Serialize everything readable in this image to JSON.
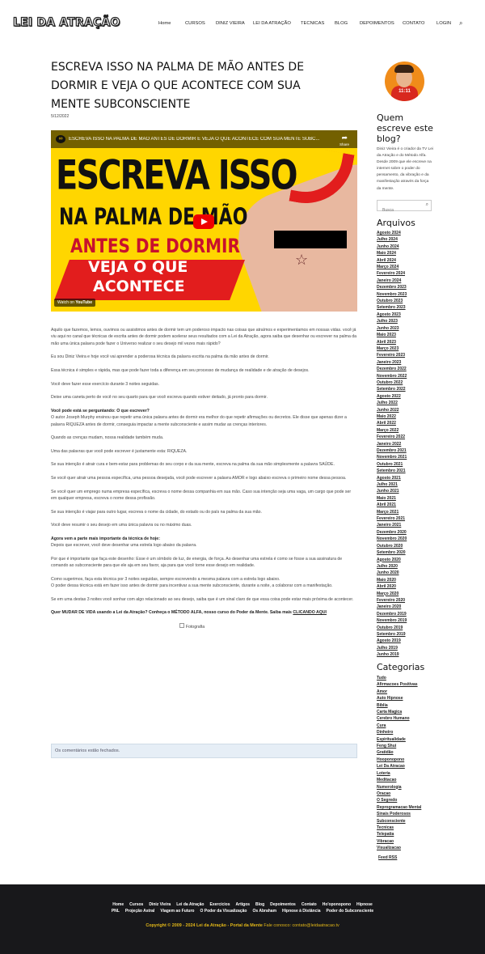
{
  "header": {
    "logo": "LEI DA ATRAÇÃO",
    "nav": [
      "Home",
      "CURSOS",
      "DINIZ VIEIRA",
      "LEI DA ATRAÇÃO",
      "TECNICAS",
      "BLOG",
      "DEPOIMENTOS",
      "CONTATO",
      "LOGIN"
    ],
    "search_icon": "search-icon"
  },
  "post": {
    "title": "ESCREVA ISSO NA PALMA DE MÃO ANTES DE DORMIR E VEJA O QUE ACONTECE COM SUA MENTE SUBCONSCIENTE",
    "date": "5/12/2022",
    "video": {
      "bar_title": "ESCREVA ISSO NA PALMA DE MÃO ANTES DE DORMIR E VEJA O QUE ACONTECE COM SUA MENTE SUBC...",
      "share": "Share",
      "line1": "ESCREVA ISSO",
      "line2": "NA PALMA DE MÃO",
      "line3": "ANTES DE DORMIR",
      "line4": "VEJA O QUE",
      "line5": "ACONTECE",
      "watch_on": "Watch on",
      "youtube": "YouTube"
    },
    "paragraphs": {
      "p1": "Aquilo que fazemos, lemos, ouvimos ou assistimos antes de dormir tem um poderoso impacto nas coisas que atraímos e experimentamos em nossas vidas. você já viu aqui no canal que técnicas de escrita antes de dormir podem acelerar seus resultados com a Lei da Atração, agora saiba que desenhar ou escrever na palma da mão uma única palavra pode fazer o Universo realizar o seu desejo mil vezes mais rápido?",
      "p2": "Eu sou Diniz Vieira e hoje você vai aprender a poderosa técnica da palavra escrita na palma da mão antes de dormir.",
      "p3": "Essa técnica é simples e rápida, mas que pode fazer toda a diferença em seu processo de mudança de realidade e de atração de desejos.",
      "p4": "Você deve fazer esse exercício durante 3 noites seguidas.",
      "p5": "Deixe uma caneta perto de você no seu quarto para que você escreva quando estiver deitado, já pronto para dormir.",
      "p6_bold": "Você pode está se perguntando: O que escrever?",
      "p6": "O autor Joseph Murphy ensinou que repetir uma única palavra antes de dormir era melhor do que repetir afirmações ou decretos. Ele disse que apenas dizer a palavra RIQUEZA antes de dormir, conseguia impactar a mente subconsciente e assim mudar as crenças interiores.",
      "p7": "Quando as crenças mudam, nossa realidade também muda.",
      "p8": "Uma das palavras que você pode escrever é justamente esta: RIQUEZA.",
      "p9": "Se sua intenção é atrair cura e bem-estar para problemas do seu corpo e da sua mente, escreva na palma da sua mão simplesmente a palavra SAÚDE.",
      "p10": "Se você quer atrair uma pessoa específica, uma pessoa desejada, você pode escrever a palavra AMOR e logo abaixo escreva o primeiro nome dessa pessoa.",
      "p11": "Se você quer um emprego numa empresa específica, escreva o nome dessa companhia em sua mão. Caso sua intenção seja uma vaga, um cargo que pode ser em qualquer empresa, escreva o nome dessa profissão.",
      "p12": "Se sua intenção é viajar para outro lugar, escreva o nome da cidade, do estado ou do país na palma da sua mão.",
      "p13": "Você deve resumir o seu desejo em uma única palavra ou no máximo duas.",
      "p14_bold": "Agora vem a parte mais importante da técnica de hoje:",
      "p14": "Depois que escrever, você deve desenhar uma estrela logo abaixo da palavra.",
      "p15": "Por que é importante que faça este desenho: Esse é um símbolo de luz, de energia, de força. Ao desenhar uma estrela é como se fosse a sua assinatura de comando ao subconsciente para que ele aja em seu favor, aja para que você torne esse desejo em realidade.",
      "p16a": "Como sugerimos, faça esta técnica por 3 noites seguidas, sempre escrevendo a mesma palavra com a estrela logo abaixo.",
      "p16b": "O poder dessa técnica está em fazer isso antes de dormir para incentivar a sua mente subconsciente, durante a noite, a colaborar com a manifestação.",
      "p17": "Se em uma destas 3 noites você sonhar com algo relacionado ao seu desejo, saiba que é um sinal claro de que essa coisa pode estar mais próxima de acontecer.",
      "cta": "Quer MUDAR DE VIDA usando a Lei da Atração? Conheça o MÉTODO ALFA, nosso curso do Poder da Mente. Saiba mais",
      "cta_link": "CLICANDO AQUI",
      "figure_alt": "Fotografia"
    },
    "comments_closed": "Os comentários estão fechados."
  },
  "sidebar": {
    "avatar_label": "11:11",
    "about_title": "Quem escreve este blog?",
    "about_text": "Diniz Vieira é o criador da TV Lei da Atração e do Método Alfa. Desde 2009 que ele escreve na internet sobre o poder do pensamento, da vibração e da manifestação através da força da mente.",
    "search_placeholder": "Busca",
    "archives_title": "Arquivos",
    "archives": [
      "Agosto 2024",
      "Julho 2024",
      "Junho 2024",
      "Maio 2024",
      "Abril 2024",
      "Março 2024",
      "Fevereiro 2024",
      "Janeiro 2024",
      "Dezembro 2023",
      "Novembro 2023",
      "Outubro 2023",
      "Setembro 2023",
      "Agosto 2023",
      "Julho 2023",
      "Junho 2023",
      "Maio 2023",
      "Abril 2023",
      "Março 2023",
      "Fevereiro 2023",
      "Janeiro 2023",
      "Dezembro 2022",
      "Novembro 2022",
      "Outubro 2022",
      "Setembro 2022",
      "Agosto 2022",
      "Julho 2022",
      "Junho 2022",
      "Maio 2022",
      "Abril 2022",
      "Março 2022",
      "Fevereiro 2022",
      "Janeiro 2022",
      "Dezembro 2021",
      "Novembro 2021",
      "Outubro 2021",
      "Setembro 2021",
      "Agosto 2021",
      "Julho 2021",
      "Junho 2021",
      "Maio 2021",
      "Abril 2021",
      "Março 2021",
      "Fevereiro 2021",
      "Janeiro 2021",
      "Dezembro 2020",
      "Novembro 2020",
      "Outubro 2020",
      "Setembro 2020",
      "Agosto 2020",
      "Julho 2020",
      "Junho 2020",
      "Maio 2020",
      "Abril 2020",
      "Março 2020",
      "Fevereiro 2020",
      "Janeiro 2020",
      "Dezembro 2019",
      "Novembro 2019",
      "Outubro 2019",
      "Setembro 2019",
      "Agosto 2019",
      "Julho 2019",
      "Junho 2019"
    ],
    "categories_title": "Categorias",
    "categories": [
      "Tudo",
      "Afirmacoes Positivas",
      "Amor",
      "Auto Hipnose",
      "Bíblia",
      "Carta Magica",
      "Cerebro Humano",
      "Cura",
      "Dinheiro",
      "Espiritualidade",
      "Feng Shui",
      "Gratidão",
      "Hooponopono",
      "Lei Da Atracao",
      "Loteria",
      "Meditacao",
      "Numerologia",
      "Oracao",
      "O Segredo",
      "Reprogramacao Mental",
      "Sinais Poderosos",
      "Subconsciente",
      "Tecnicas",
      "Telepatia",
      "Vibracao",
      "Visualizacao"
    ],
    "feed": "Feed RSS"
  },
  "footer": {
    "row1": [
      "Home",
      "Cursos",
      "Diniz Vieira",
      "Lei da Atração",
      "Exercícios",
      "Artigos",
      "Blog",
      "Depoimentos",
      "Contato",
      "Ho'oponopono",
      "Hipnose"
    ],
    "row2": [
      "PNL",
      "Projeção Astral",
      "Viagem ao Futuro",
      "O Poder da Visualização",
      "Os Abraham",
      "Hipnose à Distância",
      "Poder do Subconsciente"
    ],
    "copyright": "Copyright © 2009 - 2024 Lei da Atração - Portal da Mente",
    "contact": "Fale conosco: contato@leidaatracao.tv"
  },
  "colors": {
    "footer_bg": "#18181b",
    "accent_yellow": "#e2b718",
    "video_yellow": "#ffd600",
    "video_red": "#e21d1d"
  }
}
